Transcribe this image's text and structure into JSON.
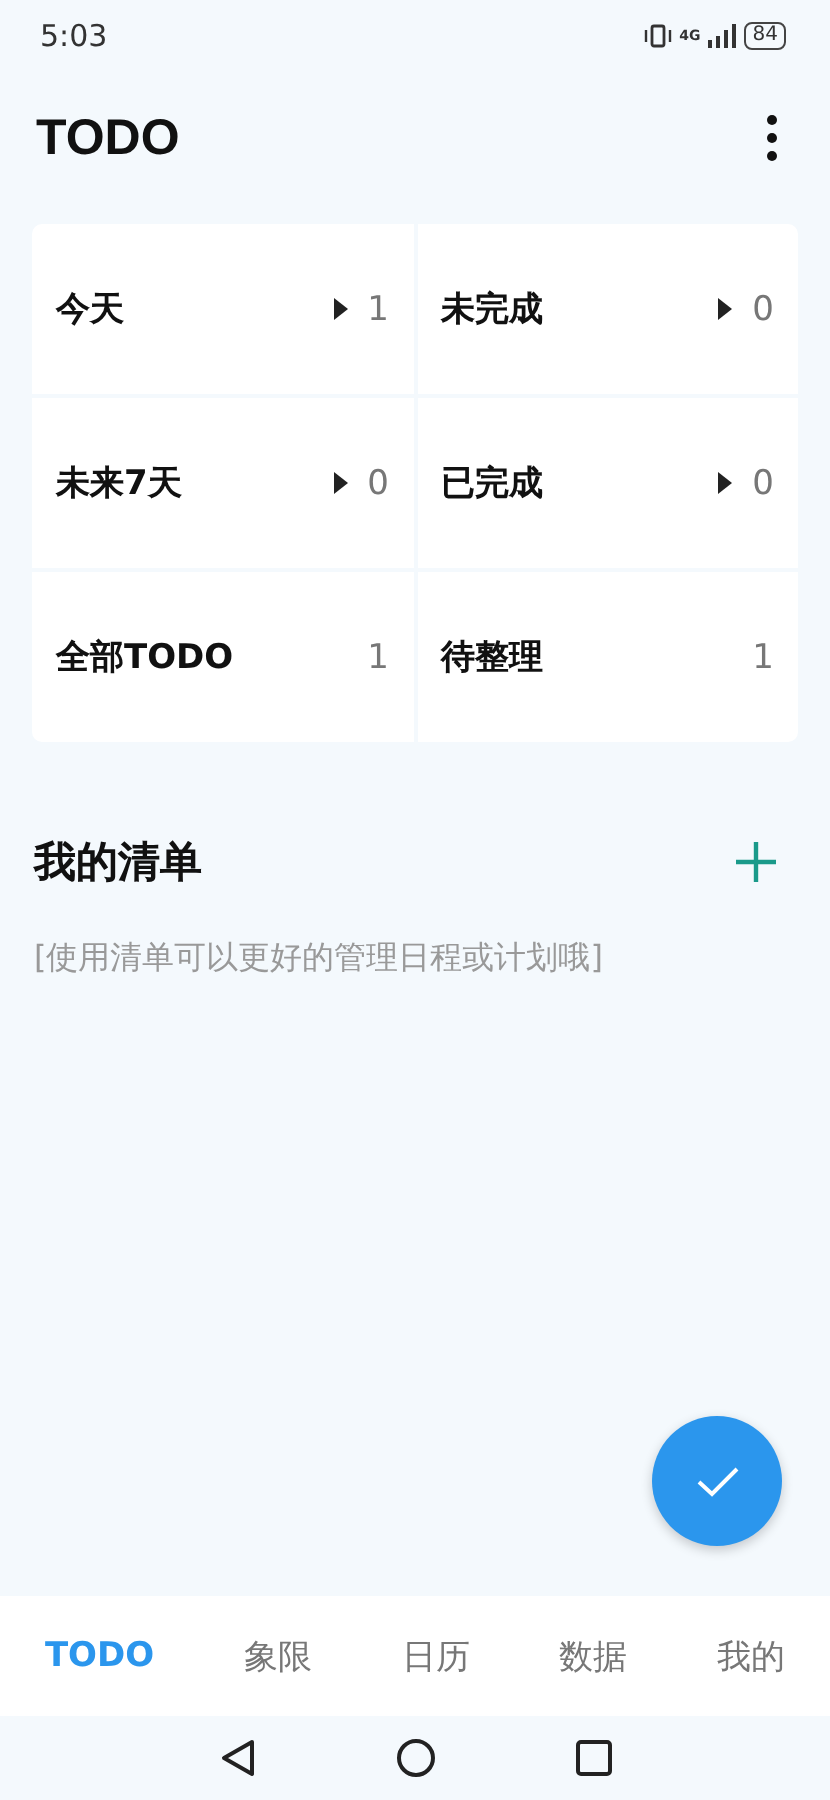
{
  "status_bar": {
    "time": "5:03",
    "network": "4G",
    "battery": "84"
  },
  "header": {
    "title": "TODO"
  },
  "filters": [
    {
      "label": "今天",
      "count": "1",
      "kind": "link"
    },
    {
      "label": "未完成",
      "count": "0",
      "kind": "link"
    },
    {
      "label": "未来7天",
      "count": "0",
      "kind": "link"
    },
    {
      "label": "已完成",
      "count": "0",
      "kind": "link"
    },
    {
      "label": "全部TODO",
      "count": "1",
      "kind": "plain"
    },
    {
      "label": "待整理",
      "count": "1",
      "kind": "plain"
    }
  ],
  "lists_section": {
    "title": "我的清单",
    "hint": "[使用清单可以更好的管理日程或计划哦]"
  },
  "tabs": [
    {
      "label": "TODO",
      "selected": true
    },
    {
      "label": "象限",
      "selected": false
    },
    {
      "label": "日历",
      "selected": false
    },
    {
      "label": "数据",
      "selected": false
    },
    {
      "label": "我的",
      "selected": false
    }
  ]
}
